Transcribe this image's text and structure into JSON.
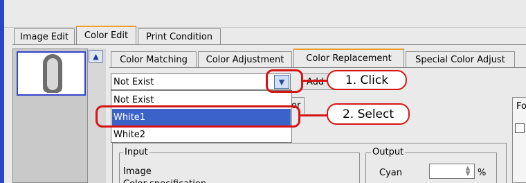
{
  "main_tabs": [
    "Image Edit",
    "Color Edit",
    "Print Condition"
  ],
  "sub_tabs": [
    "Color Matching",
    "Color Adjustment",
    "Color Replacement",
    "Special Color Adjust"
  ],
  "select": {
    "value": "Not Exist"
  },
  "add_button_label": "Add",
  "dropdown_options": [
    "Not Exist",
    "White1",
    "White2"
  ],
  "partial_tab_label": "or",
  "side_panel_label": "Fo",
  "input_group": {
    "legend": "Input",
    "image_label": "Image",
    "next_label": "Color specification"
  },
  "output_group": {
    "legend": "Output",
    "cyan_label": "Cyan",
    "unit": "%"
  },
  "annotations": {
    "step1": "1. Click",
    "step2": "2. Select"
  },
  "colors": {
    "annotation_red": "#d61414",
    "selection_blue": "#3a62c9",
    "active_tab_accent": "#f0a030"
  },
  "icons": {
    "scroll_up": "chevron-up-icon",
    "dropdown": "chevron-down-icon",
    "spinner": "spinner-arrows-icon",
    "thumbnail": "image-thumbnail"
  }
}
